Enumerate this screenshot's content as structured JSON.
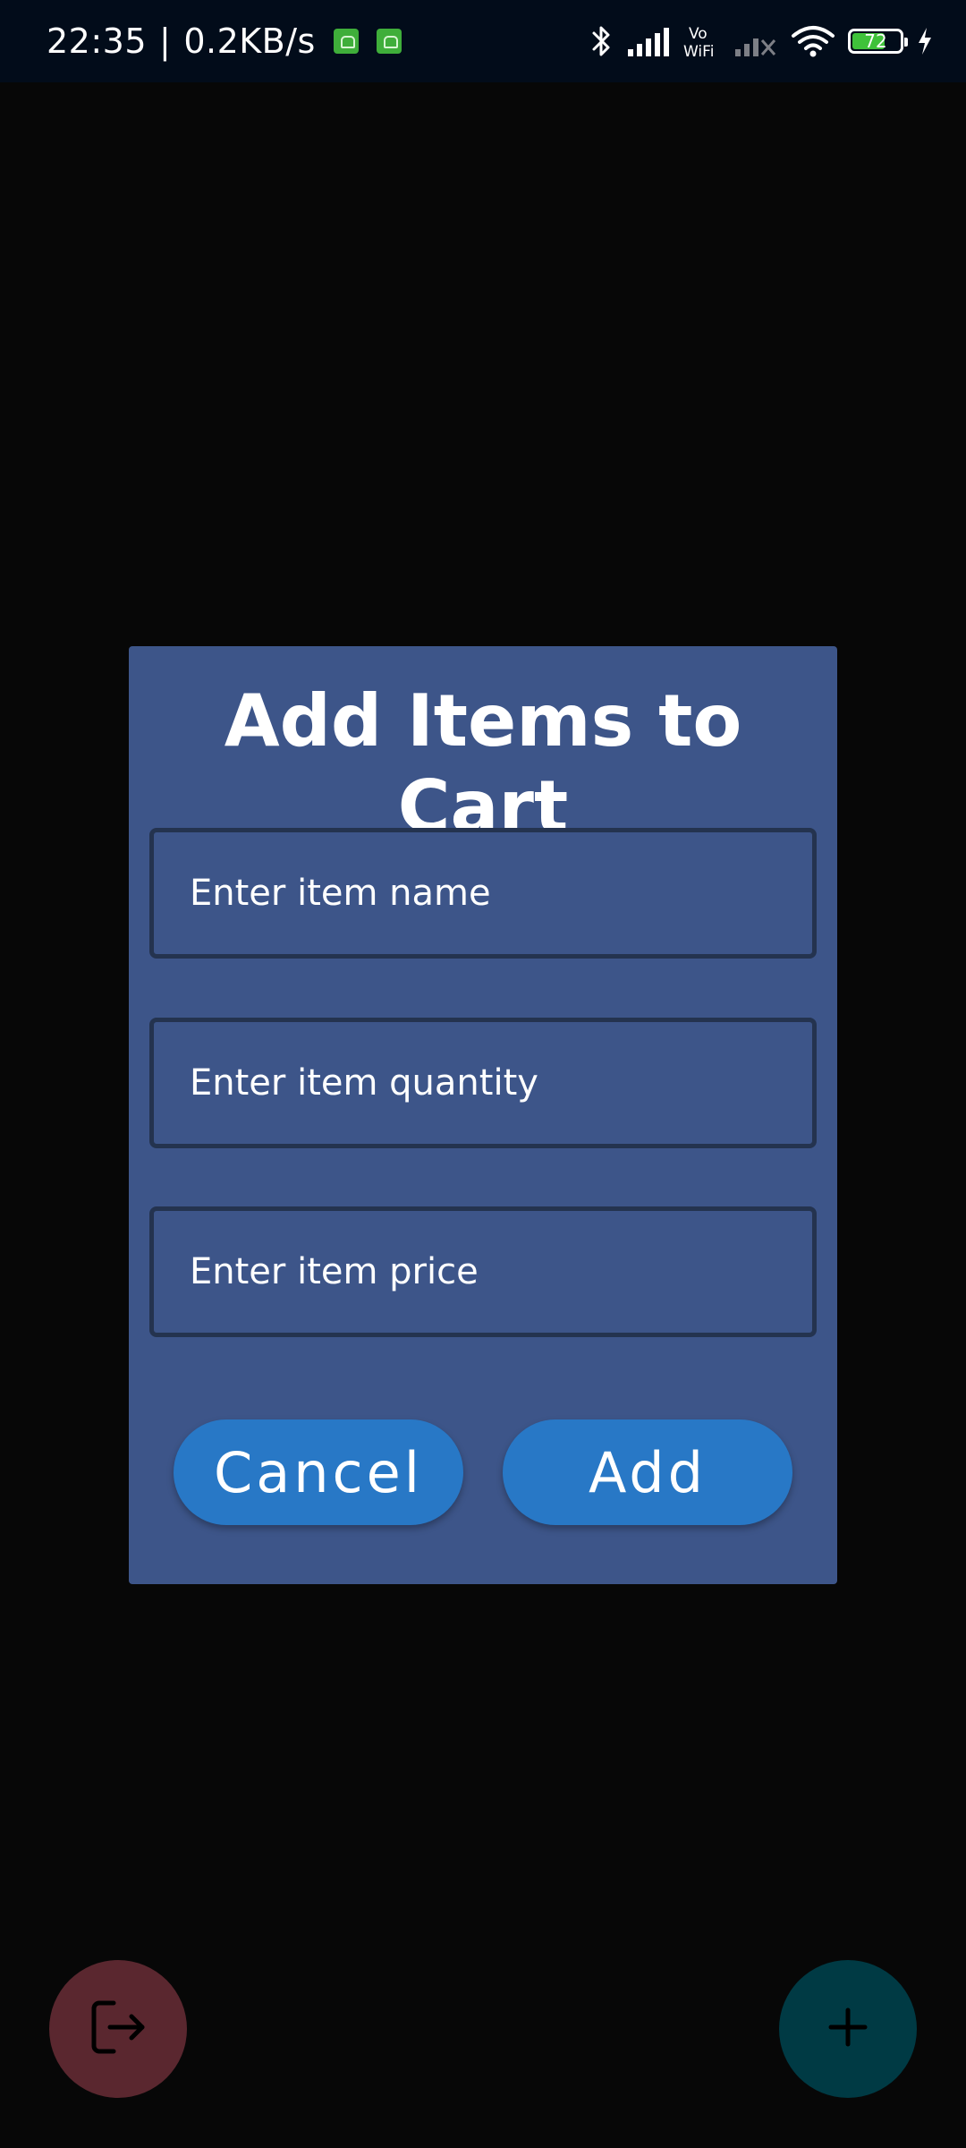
{
  "status_bar": {
    "time": "22:35",
    "separator": "|",
    "net_speed": "0.2KB/s",
    "battery_level": "72",
    "battery_percent": 72,
    "icons": [
      "app-notification-icon",
      "app-notification-icon",
      "bluetooth-icon",
      "signal-icon",
      "vowifi-icon",
      "no-signal-icon",
      "wifi-icon",
      "battery-icon",
      "charging-icon"
    ]
  },
  "dialog": {
    "title": "Add Items to Cart",
    "name_placeholder": "Enter item name",
    "quantity_placeholder": "Enter item quantity",
    "price_placeholder": "Enter item price",
    "cancel_label": "Cancel",
    "add_label": "Add",
    "background_color": "#3d5589",
    "button_color": "#2878c6"
  },
  "fabs": {
    "logout_icon": "logout-icon",
    "add_icon": "plus-icon",
    "logout_color": "#5a272f",
    "add_color": "#003a44"
  }
}
